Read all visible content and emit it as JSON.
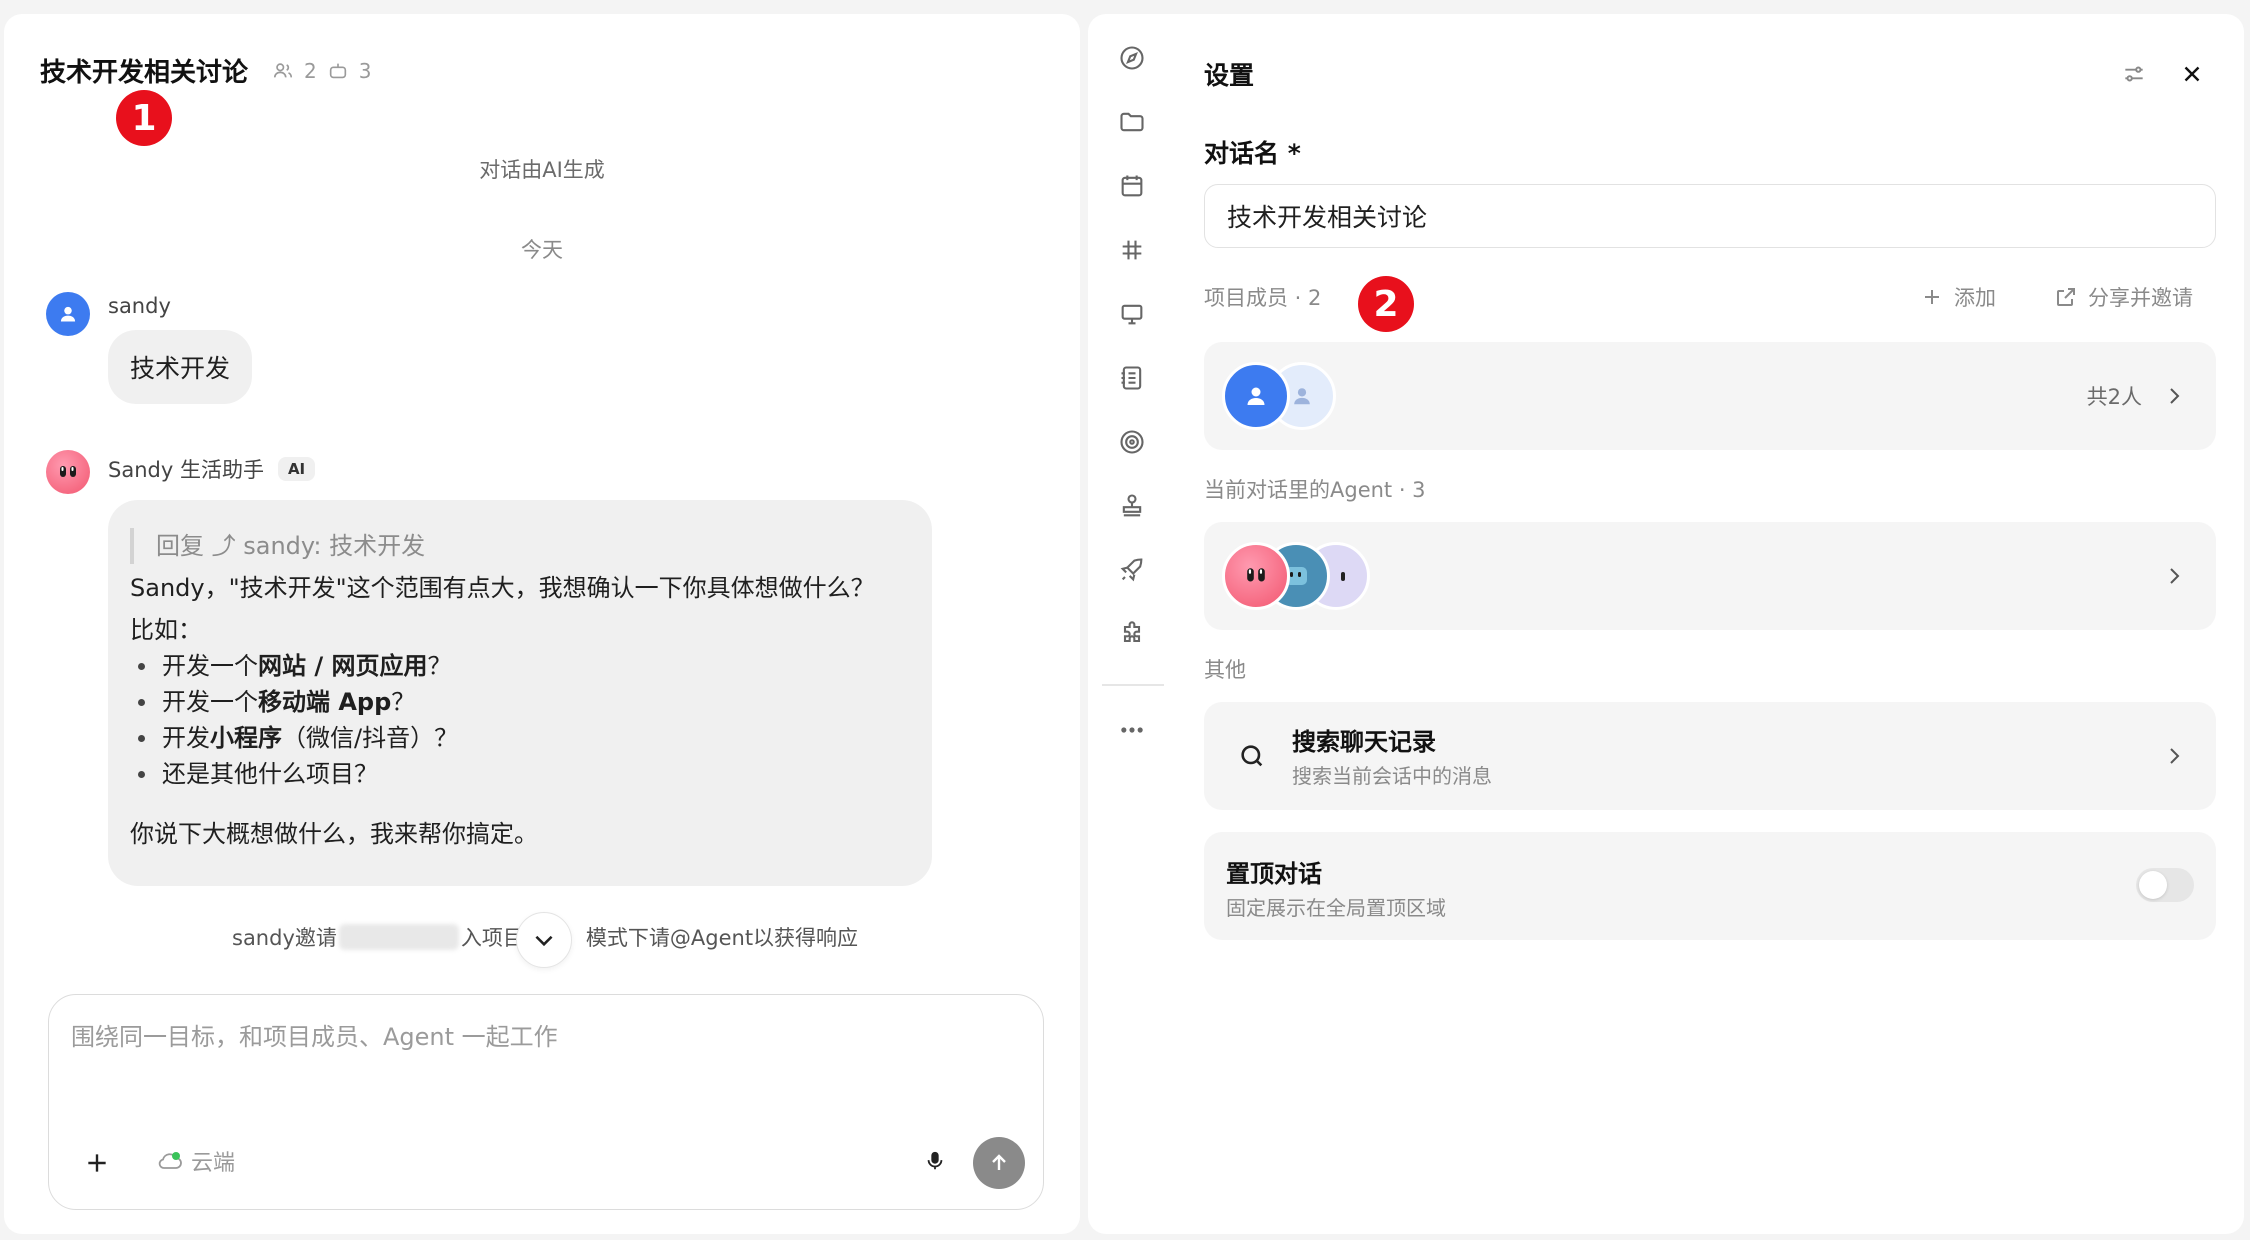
{
  "chat": {
    "title": "技术开发相关讨论",
    "member_count": "2",
    "agent_count": "3",
    "generated_note": "对话由AI生成",
    "date_divider": "今天",
    "messages": {
      "user_name": "sandy",
      "user_text": "技术开发",
      "bot_name": "Sandy 生活助手",
      "bot_tag": "AI",
      "reply_quote": "回复 ⤴ sandy:  技术开发",
      "bot_intro": "Sandy，\"技术开发\"这个范围有点大，我想确认一下你具体想做什么？",
      "examples_label": "比如：",
      "items": [
        {
          "pre": "开发一个",
          "bold": "网站 / 网页应用",
          "post": "？"
        },
        {
          "pre": "开发一个",
          "bold": "移动端 App",
          "post": "？"
        },
        {
          "pre": "开发",
          "bold": "小程序",
          "post": "（微信/抖音）？"
        },
        {
          "pre": "还是其他什么项目？",
          "bold": "",
          "post": ""
        }
      ],
      "bot_outro": "你说下大概想做什么，我来帮你搞定。"
    },
    "system_left": "sandy邀请",
    "system_mid": "入项目",
    "system_right": "模式下请@Agent以获得响应"
  },
  "composer": {
    "placeholder": "围绕同一目标，和项目成员、Agent 一起工作",
    "cloud_label": "云端"
  },
  "annotations": {
    "one": "1",
    "two": "2"
  },
  "settings": {
    "title": "设置",
    "name_label": "对话名 *",
    "name_value": "技术开发相关讨论",
    "members_label": "项目成员 · 2",
    "add_label": "添加",
    "share_label": "分享并邀请",
    "members_total": "共2人",
    "agents_label": "当前对话里的Agent · 3",
    "other_label": "其他",
    "search_title": "搜索聊天记录",
    "search_sub": "搜索当前会话中的消息",
    "pin_title": "置顶对话",
    "pin_sub": "固定展示在全局置顶区域",
    "pin_enabled": false
  },
  "colors": {
    "accent_blue": "#3d7bf0",
    "annotation_red": "#e8101c",
    "bot_pink": "#f2566f"
  },
  "icons": [
    "compass-icon",
    "folder-icon",
    "calendar-icon",
    "hashtag-icon",
    "presentation-icon",
    "notebook-icon",
    "target-icon",
    "stamp-icon",
    "rocket-icon",
    "puzzle-icon",
    "more-icon"
  ]
}
